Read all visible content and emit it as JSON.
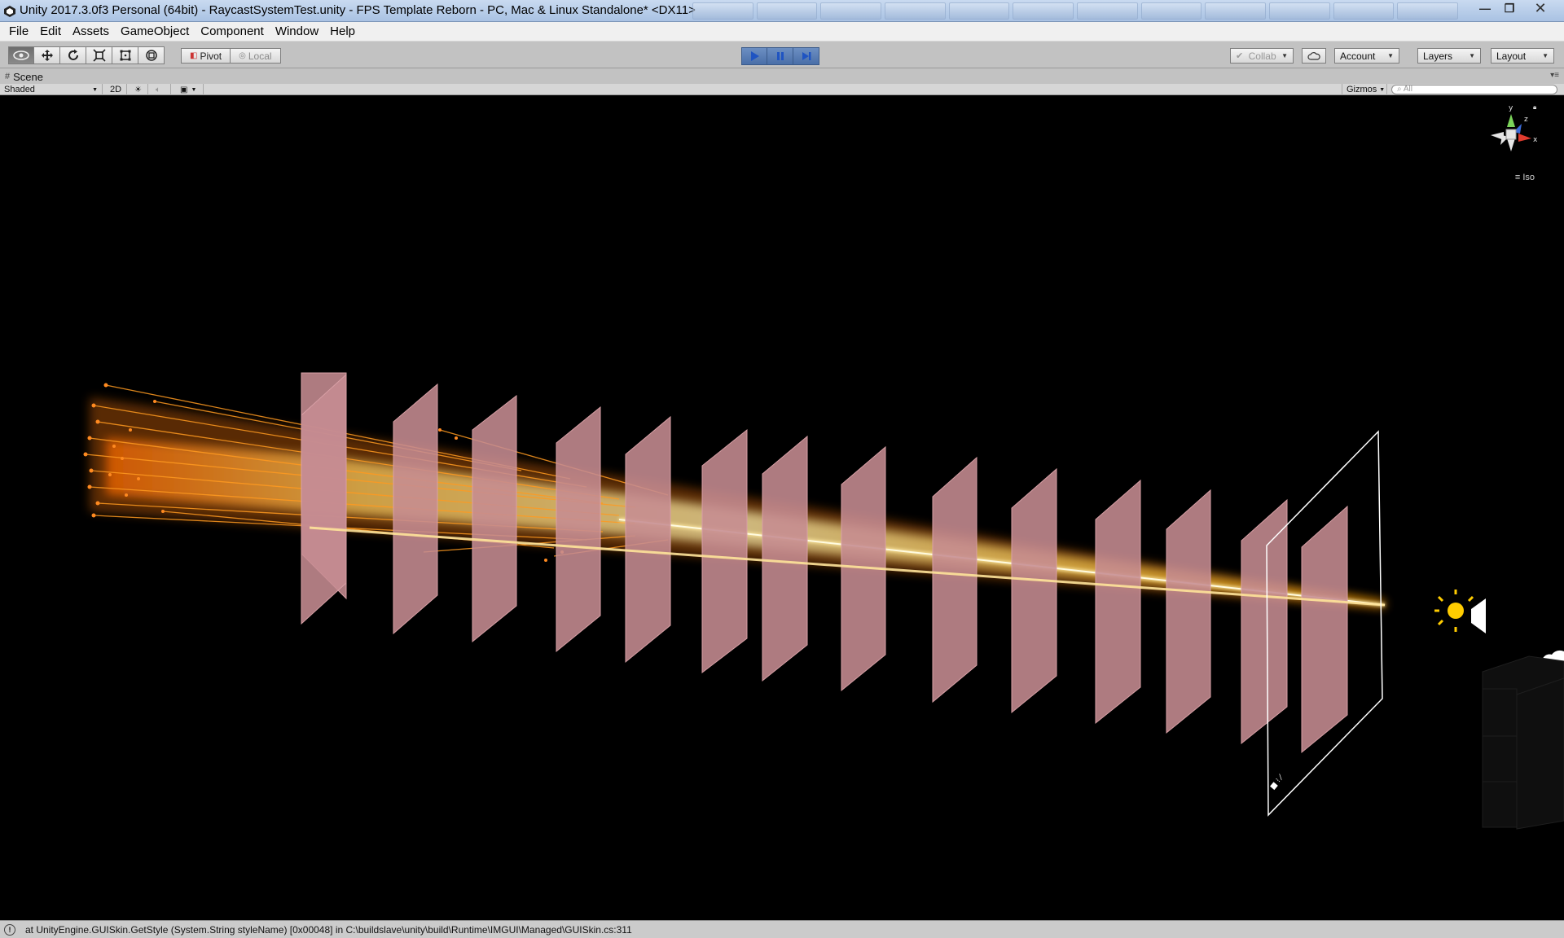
{
  "window": {
    "title": "Unity 2017.3.0f3 Personal (64bit) - RaycastSystemTest.unity - FPS Template Reborn - PC, Mac & Linux Standalone* <DX11>",
    "controls": [
      "—",
      "❐",
      "✕"
    ]
  },
  "menu": [
    "File",
    "Edit",
    "Assets",
    "GameObject",
    "Component",
    "Window",
    "Help"
  ],
  "toolbar": {
    "tools": [
      "view-tool",
      "move-tool",
      "rotate-tool",
      "scale-tool",
      "rect-tool",
      "transform-tool"
    ],
    "pivot_label": "Pivot",
    "local_label": "Local",
    "collab_label": "Collab",
    "account_label": "Account",
    "layers_label": "Layers",
    "layout_label": "Layout"
  },
  "scene_tab": {
    "label": "Scene"
  },
  "scene_toolbar": {
    "shading_mode": "Shaded",
    "mode_2d": "2D",
    "gizmos_label": "Gizmos",
    "search_placeholder": "All"
  },
  "viewport": {
    "projection_label": "Iso",
    "gizmo_axes": {
      "y": "y",
      "z": "z",
      "x": "x"
    },
    "beam_color": "#ffc830",
    "panel_color": "#c68c92",
    "panel_count": 14
  },
  "status": {
    "message": "at UnityEngine.GUISkin.GetStyle (System.String styleName) [0x00048] in C:\\buildslave\\unity\\build\\Runtime\\IMGUI\\Managed\\GUISkin.cs:311"
  },
  "colors": {
    "accent_play": "#4a6fa8",
    "titlebar": "#b8cce9",
    "toolbar": "#c2c2c2"
  }
}
